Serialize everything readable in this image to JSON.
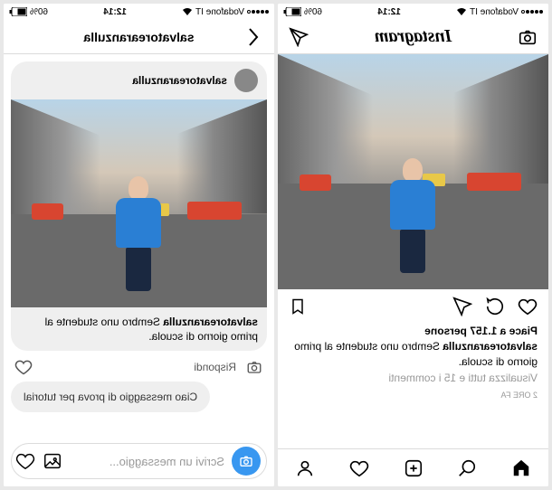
{
  "status": {
    "carrier": "Vodafone IT",
    "time": "12:14",
    "battery": "60%",
    "wifi": "●"
  },
  "feed": {
    "logo": "Instagram",
    "post": {
      "username": "salvatorearanzulla",
      "likes": "Piace a 1.157 persone",
      "caption_user": "salvatorearanzulla",
      "caption_text": " Sembro uno studente al primo giorno di scuola.",
      "comments": "Visualizza tutti e 15 i commenti",
      "time": "2 ORE FA"
    }
  },
  "dm": {
    "header_title": "salvatorearanzulla",
    "shared": {
      "username": "salvatorearanzulla",
      "caption_user": "salvatorearanzulla",
      "caption_text": " Sembro uno studente al primo giorno di scuola."
    },
    "reply_label": "Rispondi",
    "sent_message": "Ciao messaggio di prova per tutorial",
    "input_placeholder": "Scrivi un messaggio..."
  }
}
